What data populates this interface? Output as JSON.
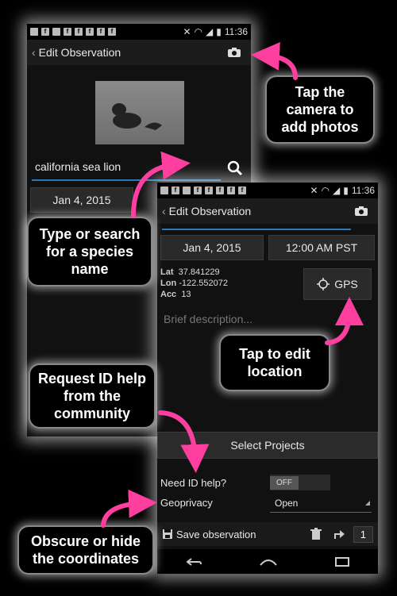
{
  "back_phone": {
    "status_time": "11:36",
    "title": "Edit Observation",
    "species_value": "california sea lion",
    "date": "Jan 4, 2015"
  },
  "front_phone": {
    "status_time": "11:36",
    "title": "Edit Observation",
    "date": "Jan 4, 2015",
    "time": "12:00 AM PST",
    "lat_label": "Lat",
    "lat_value": "37.841229",
    "lon_label": "Lon",
    "lon_value": "-122.552072",
    "acc_label": "Acc",
    "acc_value": "13",
    "gps_label": "GPS",
    "description_placeholder": "Brief description...",
    "select_projects": "Select Projects",
    "id_help_label": "Need ID help?",
    "id_help_toggle": "OFF",
    "geoprivacy_label": "Geoprivacy",
    "geoprivacy_value": "Open",
    "save_label": "Save observation",
    "count": "1"
  },
  "callouts": {
    "camera": "Tap the camera to add photos",
    "species": "Type or search for a species name",
    "location": "Tap to edit location",
    "id_help": "Request ID help from the community",
    "coordinates": "Obscure or hide the coordinates"
  },
  "colors": {
    "arrow": "#ff3fa0",
    "toggle_off": "#555555"
  }
}
